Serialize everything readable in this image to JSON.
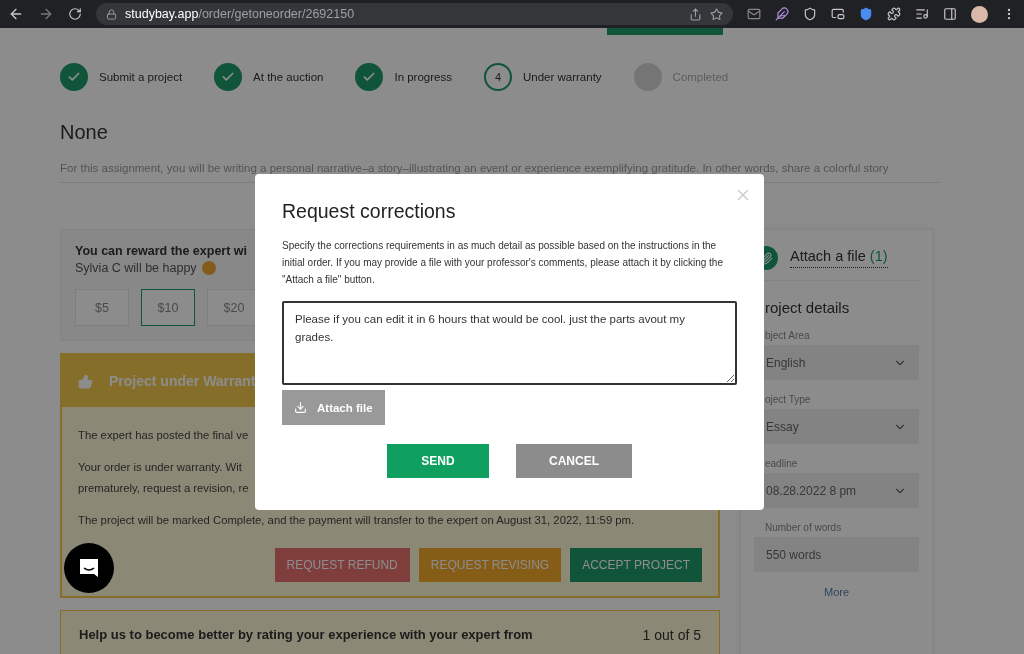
{
  "browser": {
    "url": "**studybay.app**/order/getoneorder/2692150"
  },
  "steps": [
    {
      "label": "Submit a project",
      "kind": "done"
    },
    {
      "label": "At the auction",
      "kind": "done"
    },
    {
      "label": "In progress",
      "kind": "done"
    },
    {
      "label": "Under warranty",
      "kind": "current",
      "number": "4"
    },
    {
      "label": "Completed",
      "kind": "pending"
    }
  ],
  "order": {
    "title": "None",
    "description": "For this assignment, you will be writing a personal narrative–a story–illustrating an event or experience exemplifying gratitude. In other words, share a colorful story"
  },
  "reward": {
    "title": "You can reward the expert wi",
    "subtitle": "Sylvia C will be happy",
    "options": [
      {
        "label": "$5",
        "selected": false
      },
      {
        "label": "$10",
        "selected": true
      },
      {
        "label": "$20",
        "selected": false
      }
    ]
  },
  "warranty": {
    "title": "Project under Warrant",
    "paragraphs": [
      [
        "The expert has posted the final ve"
      ],
      [
        "Your order is under warranty. Wit",
        "prematurely, request a revision, re"
      ],
      [
        "The project will be marked Complete, and the payment will transfer to the expert on August 31, 2022, 11:59 pm."
      ]
    ],
    "actions": [
      {
        "label": "REQUEST REFUND",
        "kind": "refund"
      },
      {
        "label": "REQUEST REVISING",
        "kind": "revise"
      },
      {
        "label": "ACCEPT PROJECT",
        "kind": "accept"
      }
    ]
  },
  "rating": {
    "prompt": "Help us to become better by rating your experience with your expert from",
    "score": "1 out of 5"
  },
  "sidebar": {
    "attach": "Attach a file",
    "attach_count": "(1)",
    "title": "roject details",
    "fields": [
      {
        "label": "bject Area",
        "value": "English",
        "kind": "select"
      },
      {
        "label": "oject Type",
        "value": "Essay",
        "kind": "select"
      },
      {
        "label": "eadline",
        "value": "08.28.2022 8 pm",
        "kind": "select"
      },
      {
        "label": "Number of words",
        "value": "550 words",
        "kind": "input"
      }
    ],
    "more": "More"
  },
  "modal": {
    "title": "Request corrections",
    "instructions": "Specify the corrections requirements in as much detail as possible based on the instructions in the initial order. If you may provide a file with your professor's comments, please attach it by clicking the \"Attach a file\" button.",
    "message": "Please if you can edit it in 6 hours that would be cool. just the parts avout my grades.",
    "attach_button": "Attach file",
    "buttons": [
      {
        "label": "SEND",
        "kind": "primary"
      },
      {
        "label": "CANCEL",
        "kind": "secondary"
      }
    ]
  }
}
